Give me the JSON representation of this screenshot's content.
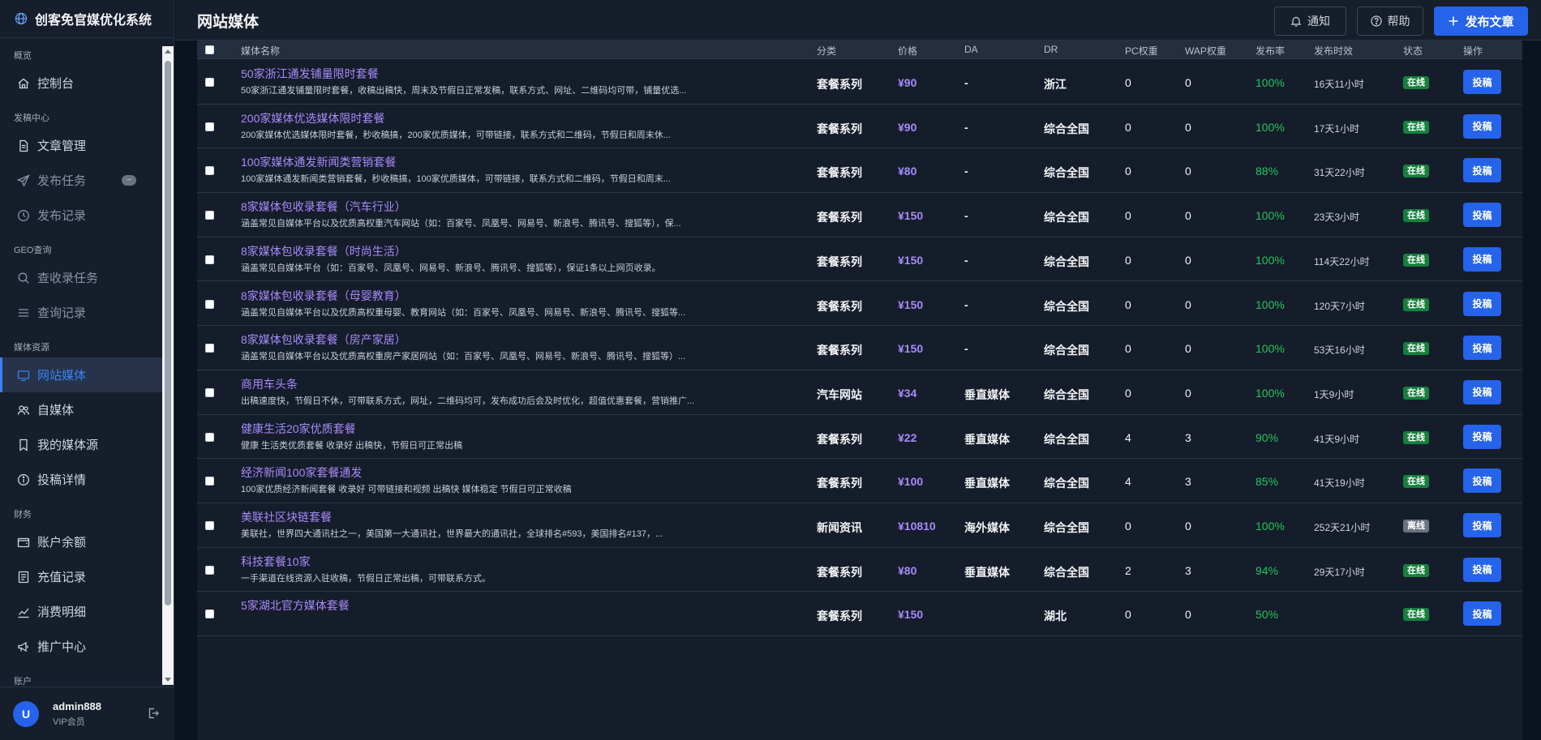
{
  "app": {
    "title": "创客免官媒优化系统"
  },
  "header": {
    "page_title": "网站媒体",
    "notify_label": "通知",
    "help_label": "帮助",
    "publish_label": "发布文章"
  },
  "sidebar": {
    "sections": [
      {
        "label": "概览",
        "items": [
          {
            "label": "控制台",
            "icon": "home-icon"
          }
        ]
      },
      {
        "label": "发稿中心",
        "items": [
          {
            "label": "文章管理",
            "icon": "document-icon"
          },
          {
            "label": "发布任务",
            "icon": "send-icon",
            "disabled": true,
            "badge": "−"
          },
          {
            "label": "发布记录",
            "icon": "clock-icon",
            "disabled": true
          }
        ]
      },
      {
        "label": "GEO查询",
        "items": [
          {
            "label": "查收录任务",
            "icon": "search-icon",
            "disabled": true
          },
          {
            "label": "查询记录",
            "icon": "list-icon",
            "disabled": true
          }
        ]
      },
      {
        "label": "媒体资源",
        "items": [
          {
            "label": "网站媒体",
            "icon": "monitor-icon",
            "active": true
          },
          {
            "label": "自媒体",
            "icon": "users-icon"
          },
          {
            "label": "我的媒体源",
            "icon": "bookmark-icon"
          },
          {
            "label": "投稿详情",
            "icon": "info-icon"
          }
        ]
      },
      {
        "label": "财务",
        "items": [
          {
            "label": "账户余额",
            "icon": "wallet-icon"
          },
          {
            "label": "充值记录",
            "icon": "receipt-icon"
          },
          {
            "label": "消费明细",
            "icon": "chart-line-icon"
          },
          {
            "label": "推广中心",
            "icon": "megaphone-icon"
          }
        ]
      },
      {
        "label": "账户",
        "items": []
      }
    ],
    "user": {
      "initial": "U",
      "name": "admin888",
      "role": "VIP会员"
    }
  },
  "table": {
    "columns": {
      "name": "媒体名称",
      "category": "分类",
      "price": "价格",
      "da": "DA",
      "dr": "DR",
      "pc": "PC权重",
      "wap": "WAP权重",
      "rate": "发布率",
      "time": "发布时效",
      "status": "状态",
      "action": "操作"
    },
    "submit_label": "投稿",
    "rows": [
      {
        "title": "50家浙江通发铺量限时套餐",
        "desc": "50家浙江通发铺量限时套餐，收稿出稿快，周末及节假日正常发稿，联系方式、网址、二维码均可带，铺量优选...",
        "category": "套餐系列",
        "price": "¥90",
        "da": "-",
        "dr": "浙江",
        "pc": "0",
        "wap": "0",
        "rate": "100%",
        "time": "16天11小时",
        "status": "在线",
        "online": true
      },
      {
        "title": "200家媒体优选媒体限时套餐",
        "desc": "200家媒体优选媒体限时套餐，秒收稿搞，200家优质媒体，可带链接，联系方式和二维码，节假日和周末休...",
        "category": "套餐系列",
        "price": "¥90",
        "da": "-",
        "dr": "综合全国",
        "pc": "0",
        "wap": "0",
        "rate": "100%",
        "time": "17天1小时",
        "status": "在线",
        "online": true
      },
      {
        "title": "100家媒体通发新闻类营销套餐",
        "desc": "100家媒体通发新闻类营销套餐，秒收稿搞，100家优质媒体，可带链接，联系方式和二维码，节假日和周末...",
        "category": "套餐系列",
        "price": "¥80",
        "da": "-",
        "dr": "综合全国",
        "pc": "0",
        "wap": "0",
        "rate": "88%",
        "time": "31天22小时",
        "status": "在线",
        "online": true
      },
      {
        "title": "8家媒体包收录套餐（汽车行业）",
        "desc": "涵盖常见自媒体平台以及优质高权重汽车网站（如：百家号、凤凰号、网易号、新浪号、腾讯号、搜狐等），保...",
        "category": "套餐系列",
        "price": "¥150",
        "da": "-",
        "dr": "综合全国",
        "pc": "0",
        "wap": "0",
        "rate": "100%",
        "time": "23天3小时",
        "status": "在线",
        "online": true
      },
      {
        "title": "8家媒体包收录套餐（时尚生活）",
        "desc": "涵盖常见自媒体平台（如：百家号、凤凰号、网易号、新浪号、腾讯号、搜狐等），保证1条以上网页收录。",
        "category": "套餐系列",
        "price": "¥150",
        "da": "-",
        "dr": "综合全国",
        "pc": "0",
        "wap": "0",
        "rate": "100%",
        "time": "114天22小时",
        "status": "在线",
        "online": true
      },
      {
        "title": "8家媒体包收录套餐（母婴教育）",
        "desc": "涵盖常见自媒体平台以及优质高权重母婴、教育网站（如：百家号、凤凰号、网易号、新浪号、腾讯号、搜狐等...",
        "category": "套餐系列",
        "price": "¥150",
        "da": "-",
        "dr": "综合全国",
        "pc": "0",
        "wap": "0",
        "rate": "100%",
        "time": "120天7小时",
        "status": "在线",
        "online": true
      },
      {
        "title": "8家媒体包收录套餐（房产家居）",
        "desc": "涵盖常见自媒体平台以及优质高权重房产家居网站（如：百家号、凤凰号、网易号、新浪号、腾讯号、搜狐等）...",
        "category": "套餐系列",
        "price": "¥150",
        "da": "-",
        "dr": "综合全国",
        "pc": "0",
        "wap": "0",
        "rate": "100%",
        "time": "53天16小时",
        "status": "在线",
        "online": true
      },
      {
        "title": "商用车头条",
        "desc": "出稿速度快，节假日不休，可带联系方式，网址，二维码均可，发布成功后会及时优化，超值优惠套餐，营销推广...",
        "category": "汽车网站",
        "price": "¥34",
        "da": "垂直媒体",
        "dr": "综合全国",
        "pc": "0",
        "wap": "0",
        "rate": "100%",
        "time": "1天9小时",
        "status": "在线",
        "online": true
      },
      {
        "title": "健康生活20家优质套餐",
        "desc": "健康 生活类优质套餐 收录好 出稿快，节假日可正常出稿",
        "category": "套餐系列",
        "price": "¥22",
        "da": "垂直媒体",
        "dr": "综合全国",
        "pc": "4",
        "wap": "3",
        "rate": "90%",
        "time": "41天9小时",
        "status": "在线",
        "online": true
      },
      {
        "title": "经济新闻100家套餐通发",
        "desc": "100家优质经济新闻套餐 收录好 可带链接和视频 出稿快 媒体稳定 节假日可正常收稿",
        "category": "套餐系列",
        "price": "¥100",
        "da": "垂直媒体",
        "dr": "综合全国",
        "pc": "4",
        "wap": "3",
        "rate": "85%",
        "time": "41天19小时",
        "status": "在线",
        "online": true
      },
      {
        "title": "美联社区块链套餐",
        "desc": "美联社，世界四大通讯社之一，美国第一大通讯社，世界最大的通讯社，全球排名#593，美国排名#137，...",
        "category": "新闻资讯",
        "price": "¥10810",
        "da": "海外媒体",
        "dr": "综合全国",
        "pc": "0",
        "wap": "0",
        "rate": "100%",
        "time": "252天21小时",
        "status": "离线",
        "online": false
      },
      {
        "title": "科技套餐10家",
        "desc": "一手渠道在线资源入驻收稿，节假日正常出稿，可带联系方式。",
        "category": "套餐系列",
        "price": "¥80",
        "da": "垂直媒体",
        "dr": "综合全国",
        "pc": "2",
        "wap": "3",
        "rate": "94%",
        "time": "29天17小时",
        "status": "在线",
        "online": true
      },
      {
        "title": "5家湖北官方媒体套餐",
        "desc": "",
        "category": "套餐系列",
        "price": "¥150",
        "da": "",
        "dr": "湖北",
        "pc": "0",
        "wap": "0",
        "rate": "50%",
        "time": "",
        "status": "在线",
        "online": true
      }
    ]
  }
}
